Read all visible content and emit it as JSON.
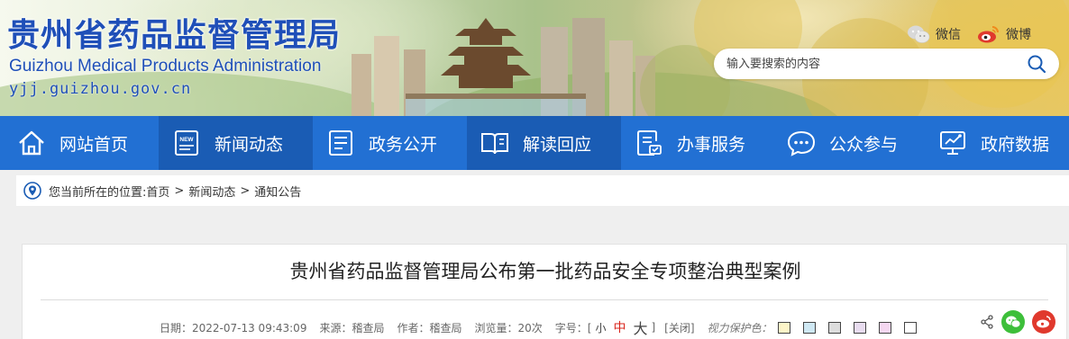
{
  "site": {
    "title_cn": "贵州省药品监督管理局",
    "title_en": "Guizhou Medical Products Administration",
    "url": "yjj.guizhou.gov.cn"
  },
  "social": {
    "wechat_label": "微信",
    "weibo_label": "微博"
  },
  "search": {
    "placeholder": "输入要搜索的内容"
  },
  "nav": {
    "items": [
      {
        "label": "网站首页",
        "icon": "home-icon"
      },
      {
        "label": "新闻动态",
        "icon": "news-icon"
      },
      {
        "label": "政务公开",
        "icon": "document-list-icon"
      },
      {
        "label": "解读回应",
        "icon": "open-book-icon"
      },
      {
        "label": "办事服务",
        "icon": "service-form-icon"
      },
      {
        "label": "公众参与",
        "icon": "chat-bubble-icon"
      },
      {
        "label": "政府数据",
        "icon": "data-monitor-icon"
      }
    ]
  },
  "breadcrumb": {
    "prefix": "您当前所在的位置:",
    "items": [
      "首页",
      "新闻动态",
      "通知公告"
    ],
    "separator": ">"
  },
  "article": {
    "title": "贵州省药品监督管理局公布第一批药品安全专项整治典型案例",
    "date": "日期：2022-07-13 09:43:09",
    "source": "来源：稽查局",
    "author": "作者：稽查局",
    "views": "浏览量：20次",
    "font_size_label": "字号：[",
    "font_small": "小",
    "font_medium": "中",
    "font_large": "大",
    "font_close": "]",
    "close": "[关闭]",
    "eye_care": "视力保护色：",
    "eye_care_colors": [
      "#fdf5c8",
      "#cfe8f3",
      "#dddddd",
      "#e8dcef",
      "#f4d7f0",
      "#ffffff"
    ]
  },
  "colors": {
    "brand_blue": "#2270d3",
    "nav_active": "#1a5cb4",
    "wechat_green": "#3dbf3a",
    "weibo_red": "#e0392d"
  }
}
